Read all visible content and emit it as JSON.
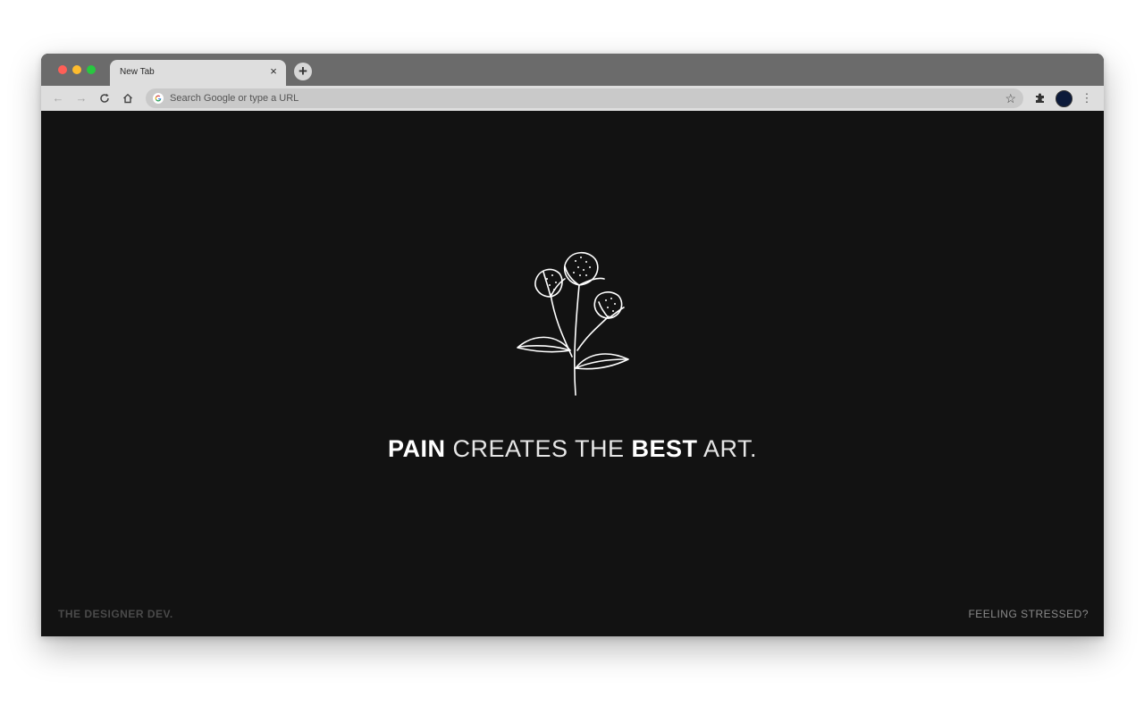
{
  "browser": {
    "tab_title": "New Tab",
    "tab_close_icon": "close-icon",
    "new_tab_icon": "plus-icon",
    "new_tab_glyph": "+",
    "tab_close_glyph": "×",
    "nav": {
      "back_glyph": "←",
      "forward_glyph": "→",
      "reload_glyph": "C",
      "home_glyph": "⌂"
    },
    "omnibox_placeholder": "Search Google or type a URL",
    "star_glyph": "☆",
    "menu_glyph": "⋮",
    "traffic_lights": [
      "#ff5f57",
      "#febc2e",
      "#28c840"
    ]
  },
  "page": {
    "background": "#121212",
    "quote": {
      "word1": "PAIN",
      "word2": " CREATES THE ",
      "word3": "BEST",
      "word4": " ART."
    },
    "footer_left": "THE DESIGNER DEV.",
    "footer_right": "FEELING STRESSED?",
    "illustration": "flower-line-art-icon"
  }
}
